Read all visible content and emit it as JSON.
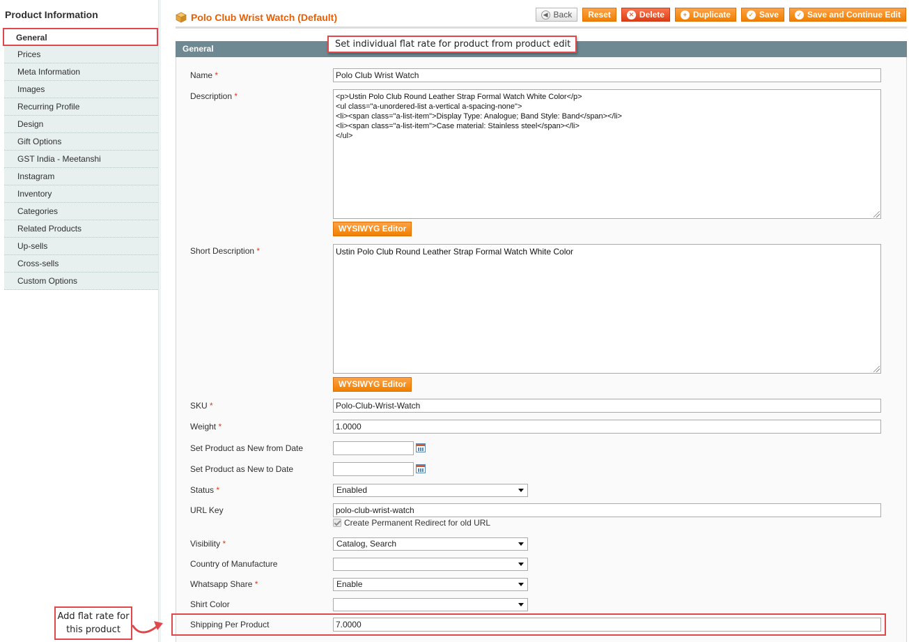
{
  "sidebar": {
    "title": "Product Information",
    "items": [
      {
        "label": "General",
        "active": true
      },
      {
        "label": "Prices"
      },
      {
        "label": "Meta Information"
      },
      {
        "label": "Images"
      },
      {
        "label": "Recurring Profile"
      },
      {
        "label": "Design"
      },
      {
        "label": "Gift Options"
      },
      {
        "label": "GST India - Meetanshi"
      },
      {
        "label": "Instagram"
      },
      {
        "label": "Inventory"
      },
      {
        "label": "Categories"
      },
      {
        "label": "Related Products"
      },
      {
        "label": "Up-sells"
      },
      {
        "label": "Cross-sells"
      },
      {
        "label": "Custom Options"
      }
    ]
  },
  "header": {
    "title": "Polo Club Wrist Watch (Default)",
    "icon": "package-icon"
  },
  "toolbar": {
    "back_label": "Back",
    "reset_label": "Reset",
    "delete_label": "Delete",
    "duplicate_label": "Duplicate",
    "save_label": "Save",
    "save_continue_label": "Save and Continue Edit"
  },
  "section": {
    "title": "General"
  },
  "annotations": {
    "top_callout": "Set individual flat rate for product from product edit",
    "bottom_callout": "Add flat rate for this product",
    "highlight_color": "#e0474b"
  },
  "form": {
    "name": {
      "label": "Name",
      "required": "*",
      "value": "Polo Club Wrist Watch"
    },
    "description": {
      "label": "Description",
      "required": "*",
      "value": "<p>Ustin Polo Club Round Leather Strap Formal Watch White Color</p>\n<ul class=\"a-unordered-list a-vertical a-spacing-none\">\n<li><span class=\"a-list-item\">Display Type: Analogue; Band Style: Band</span></li>\n<li><span class=\"a-list-item\">Case material: Stainless steel</span></li>\n</ul>"
    },
    "wysiwyg_label": "WYSIWYG Editor",
    "short_description": {
      "label": "Short Description",
      "required": "*",
      "value": "Ustin Polo Club Round Leather Strap Formal Watch White Color"
    },
    "sku": {
      "label": "SKU",
      "required": "*",
      "value": "Polo-Club-Wrist-Watch"
    },
    "weight": {
      "label": "Weight",
      "required": "*",
      "value": "1.0000"
    },
    "new_from": {
      "label": "Set Product as New from Date",
      "value": ""
    },
    "new_to": {
      "label": "Set Product as New to Date",
      "value": ""
    },
    "status": {
      "label": "Status",
      "required": "*",
      "value": "Enabled"
    },
    "url_key": {
      "label": "URL Key",
      "value": "polo-club-wrist-watch",
      "redirect_label": "Create Permanent Redirect for old URL"
    },
    "visibility": {
      "label": "Visibility",
      "required": "*",
      "value": "Catalog, Search"
    },
    "country": {
      "label": "Country of Manufacture",
      "value": ""
    },
    "whatsapp": {
      "label": "Whatsapp Share",
      "required": "*",
      "value": "Enable"
    },
    "shirt_color": {
      "label": "Shirt Color",
      "value": ""
    },
    "shipping": {
      "label": "Shipping Per Product",
      "value": "7.0000"
    }
  },
  "colors": {
    "accent_orange": "#f08000",
    "title_orange": "#eb5e00",
    "section_header": "#6f8992",
    "sidebar_bg": "#e7efef"
  }
}
